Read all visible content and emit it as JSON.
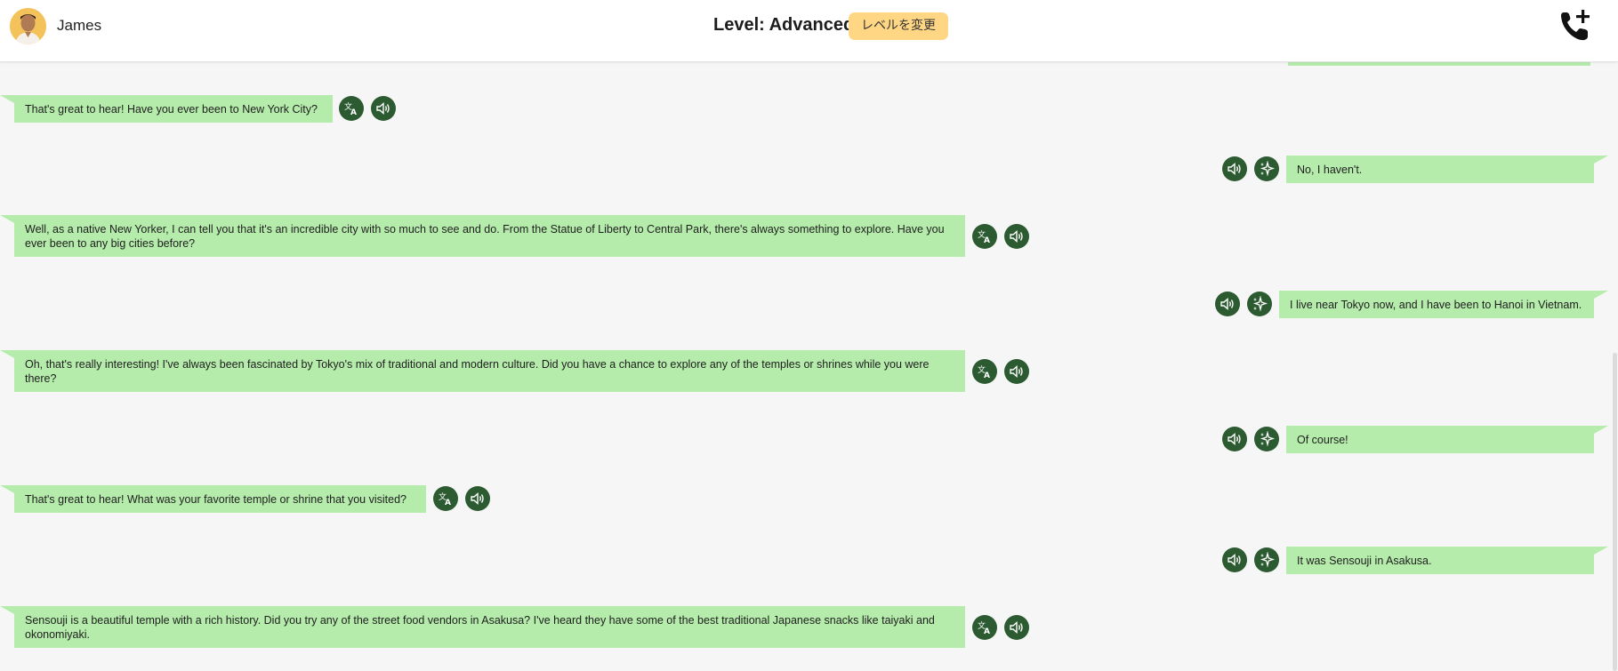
{
  "header": {
    "username": "James",
    "level_title": "Level: Advanced",
    "change_level_label": "レベルを変更"
  },
  "messages": [
    {
      "side": "left",
      "text": "That's great to hear! Have you ever been to New York City?"
    },
    {
      "side": "right",
      "text": "No, I haven't."
    },
    {
      "side": "left",
      "text": "Well, as a native New Yorker, I can tell you that it's an incredible city with so much to see and do. From the Statue of Liberty to Central Park, there's always something to explore. Have you ever been to any big cities before?"
    },
    {
      "side": "right",
      "text": "I live near Tokyo now, and I have been to Hanoi in Vietnam."
    },
    {
      "side": "left",
      "text": "Oh, that's really interesting! I've always been fascinated by Tokyo's mix of traditional and modern culture. Did you have a chance to explore any of the temples or shrines while you were there?"
    },
    {
      "side": "right",
      "text": "Of course!"
    },
    {
      "side": "left",
      "text": "That's great to hear! What was your favorite temple or shrine that you visited?"
    },
    {
      "side": "right",
      "text": "It was Sensouji in Asakusa."
    },
    {
      "side": "left",
      "text": "Sensouji is a beautiful temple with a rich history. Did you try any of the street food vendors in Asakusa? I've heard they have some of the best traditional Japanese snacks like taiyaki and okonomiyaki."
    }
  ],
  "icons": {
    "translate": "translate-icon",
    "speaker": "speaker-icon",
    "sparkle": "sparkle-icon",
    "add_call": "add-call-icon"
  },
  "colors": {
    "bubble": "#b5ecab",
    "icon_button": "#2c5a31",
    "level_button": "#ffd784",
    "background": "#f6f6f6"
  }
}
